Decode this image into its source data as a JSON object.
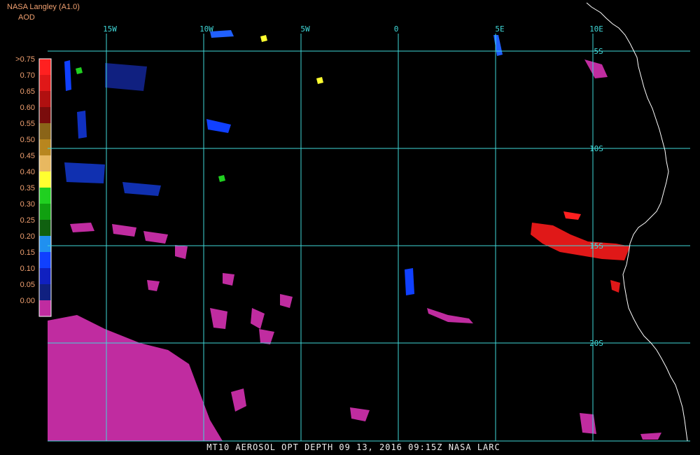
{
  "header": {
    "title": "NASA Langley (A1.0)",
    "product": "AOD"
  },
  "footer": {
    "caption": "MT10  AEROSOL OPT DEPTH   09 13, 2016 09:15Z   NASA LARC"
  },
  "grid_color": "#40d8d8",
  "coast_color": "#ffffff",
  "longitude_labels": [
    "15W",
    "10W",
    "5W",
    "0",
    "5E",
    "10E"
  ],
  "latitude_labels": [
    "5S",
    "10S",
    "15S",
    "20S"
  ],
  "color_scale": [
    {
      "label": ">0.75",
      "color": "#ff2020"
    },
    {
      "label": "0.70",
      "color": "#e01818"
    },
    {
      "label": "0.65",
      "color": "#b01010"
    },
    {
      "label": "0.60",
      "color": "#7a0c0c"
    },
    {
      "label": "0.55",
      "color": "#8a6418"
    },
    {
      "label": "0.50",
      "color": "#b8861e"
    },
    {
      "label": "0.45",
      "color": "#e8b860"
    },
    {
      "label": "0.40",
      "color": "#ffff30"
    },
    {
      "label": "0.35",
      "color": "#20d020"
    },
    {
      "label": "0.30",
      "color": "#10a010"
    },
    {
      "label": "0.25",
      "color": "#106010"
    },
    {
      "label": "0.20",
      "color": "#2090f0"
    },
    {
      "label": "0.15",
      "color": "#1040ff"
    },
    {
      "label": "0.10",
      "color": "#1020c0"
    },
    {
      "label": "0.05",
      "color": "#102080"
    },
    {
      "label": "0.00",
      "color": "#c02ca0"
    }
  ]
}
